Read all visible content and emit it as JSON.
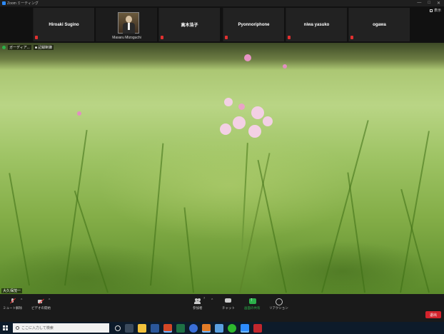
{
  "window": {
    "title": "Zoom ミーティング",
    "controls": [
      "—",
      "□",
      "✕"
    ]
  },
  "participants": [
    {
      "name": "Hiroaki Sugino",
      "muted": true,
      "video": false
    },
    {
      "name": "Masaru Mizoguchi",
      "muted": true,
      "video": true
    },
    {
      "name": "高木浩子",
      "muted": true,
      "video": false
    },
    {
      "name": "Pyonnoriphone",
      "muted": true,
      "video": false
    },
    {
      "name": "niwa yasuko",
      "muted": true,
      "video": false
    },
    {
      "name": "ogawa",
      "muted": false,
      "video": false
    }
  ],
  "view_button": {
    "label": "表示"
  },
  "main_video": {
    "status_label": "ガーディア...",
    "recording_label": "■ 記録制御",
    "speaker_name": "大久保茂一"
  },
  "toolbar": {
    "mute_label": "ミュート解除",
    "video_label": "ビデオの開始",
    "participants_label": "参加者",
    "participants_count": "7",
    "chat_label": "チャット",
    "share_label": "画面の共有",
    "reactions_label": "リアクション",
    "leave_label": "退出",
    "caret": "^"
  },
  "taskbar": {
    "search_placeholder": "ここに入力して検索"
  },
  "colors": {
    "accent_red": "#d3232c",
    "share_green": "#2bb14a",
    "mute_red": "#e23030"
  }
}
